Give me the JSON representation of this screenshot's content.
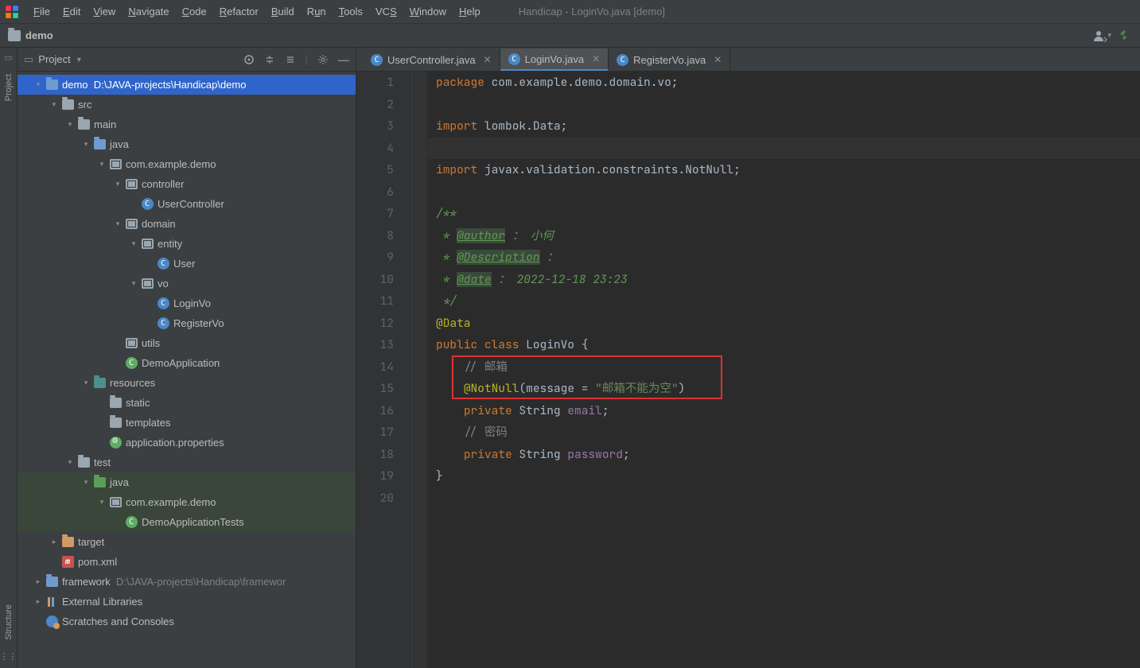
{
  "menubar": {
    "items": [
      "File",
      "Edit",
      "View",
      "Navigate",
      "Code",
      "Refactor",
      "Build",
      "Run",
      "Tools",
      "VCS",
      "Window",
      "Help"
    ],
    "window_title": "Handicap - LoginVo.java [demo]"
  },
  "crumb": {
    "label": "demo"
  },
  "stripe": {
    "project": "Project",
    "structure": "Structure"
  },
  "project_header": {
    "title": "Project"
  },
  "tree": {
    "demo": "demo",
    "demo_path": "D:\\JAVA-projects\\Handicap\\demo",
    "src": "src",
    "main": "main",
    "java": "java",
    "pkg": "com.example.demo",
    "controller": "controller",
    "usercontroller": "UserController",
    "domain": "domain",
    "entity": "entity",
    "user": "User",
    "vo": "vo",
    "loginvo": "LoginVo",
    "registervo": "RegisterVo",
    "utils": "utils",
    "demoapp": "DemoApplication",
    "resources": "resources",
    "static": "static",
    "templates": "templates",
    "appprops": "application.properties",
    "test": "test",
    "testjava": "java",
    "testpkg": "com.example.demo",
    "testclass": "DemoApplicationTests",
    "target": "target",
    "pom": "pom.xml",
    "framework": "framework",
    "framework_path": "D:\\JAVA-projects\\Handicap\\framewor",
    "extlib": "External Libraries",
    "scratches": "Scratches and Consoles"
  },
  "tabs": {
    "t1": "UserController.java",
    "t2": "LoginVo.java",
    "t3": "RegisterVo.java"
  },
  "code": {
    "l1_kw": "package",
    "l1_pkg": " com.example.demo.domain.vo;",
    "l3_kw": "import",
    "l3_pkg": " lombok.",
    "l3_d": "Data",
    "l3_s": ";",
    "l5_kw": "import",
    "l5_pkg": " javax.validation.constraints.",
    "l5_d": "NotNull",
    "l5_s": ";",
    "l7": "/**",
    "l8a": " * ",
    "l8t": "@author",
    "l8b": " ： ",
    "l8c": "小何",
    "l9a": " * ",
    "l9t": "@Description",
    "l9b": " ：",
    "l10a": " * ",
    "l10t": "@date",
    "l10b": " ： 2022-12-18 23:23",
    "l11": " */",
    "l12": "@Data",
    "l13a": "public class ",
    "l13b": "LoginVo ",
    "l13c": "{",
    "l14": "    // 邮箱",
    "l15a": "    ",
    "l15ann": "@NotNull",
    "l15b": "(message = ",
    "l15s": "\"邮箱不能为空\"",
    "l15c": ")",
    "l16a": "    ",
    "l16kw": "private ",
    "l16ty": "String ",
    "l16f": "email",
    "l16s": ";",
    "l17": "    // 密码",
    "l18a": "    ",
    "l18kw": "private ",
    "l18ty": "String ",
    "l18f": "password",
    "l18s": ";",
    "l19": "}"
  },
  "lines": [
    "1",
    "2",
    "3",
    "4",
    "5",
    "6",
    "7",
    "8",
    "9",
    "10",
    "11",
    "12",
    "13",
    "14",
    "15",
    "16",
    "17",
    "18",
    "19",
    "20"
  ]
}
